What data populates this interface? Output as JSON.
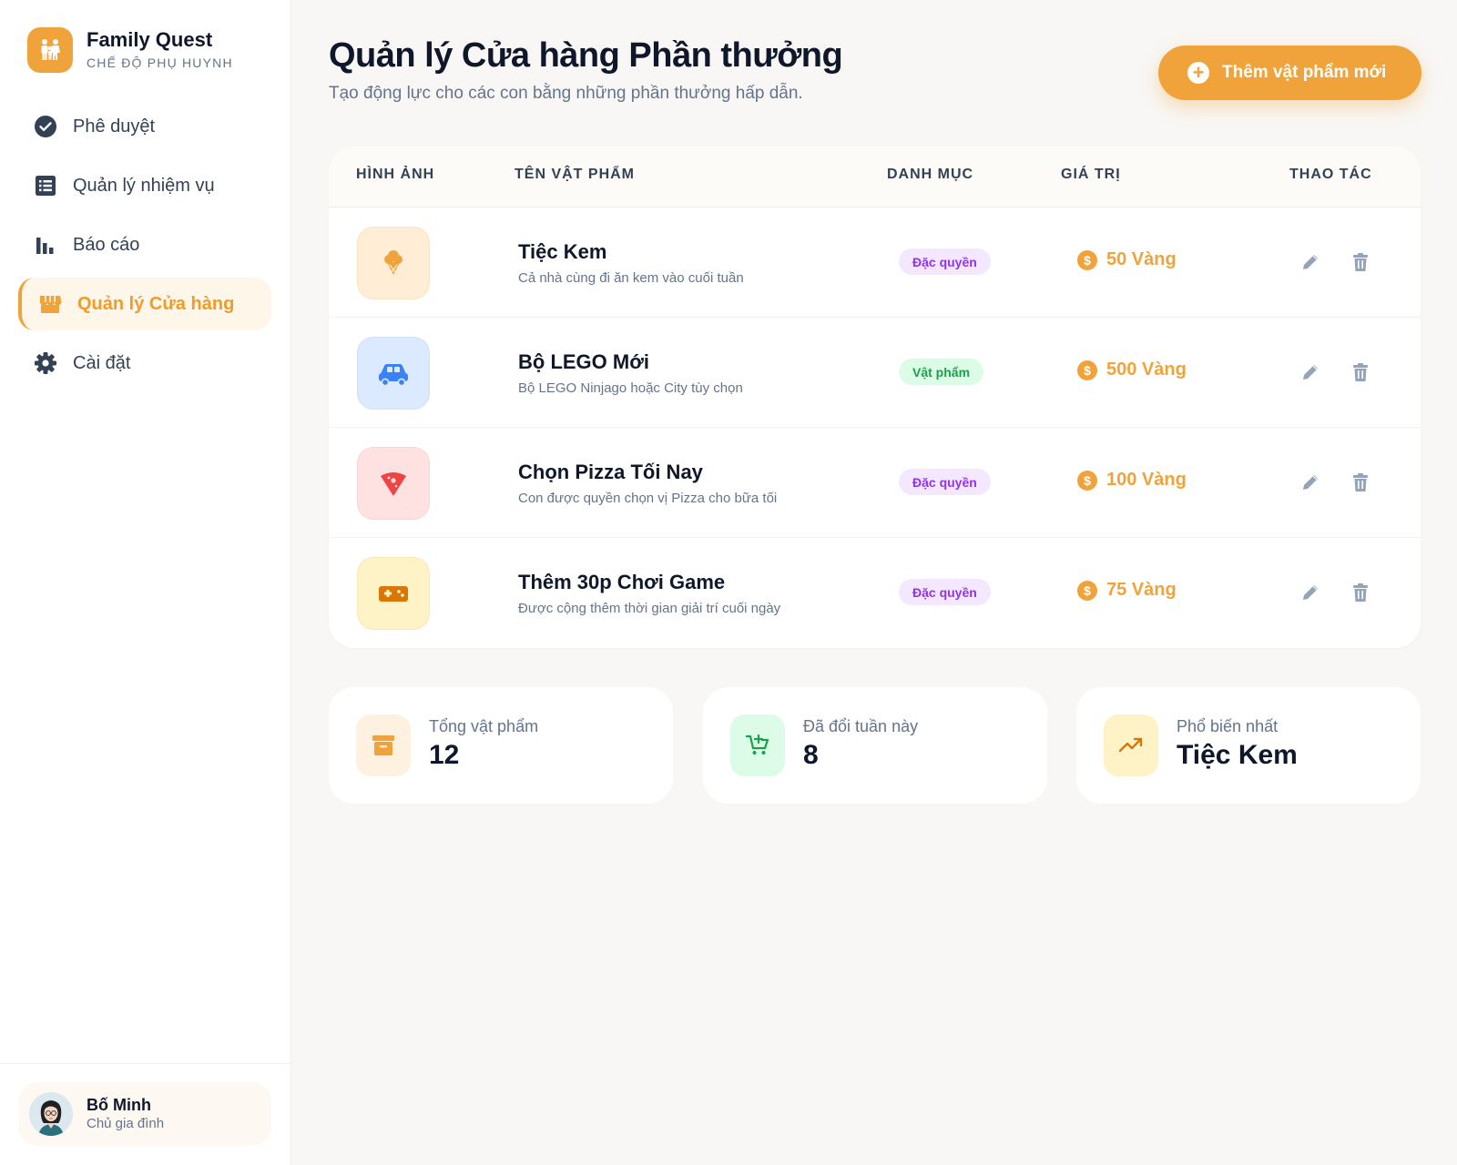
{
  "brand": {
    "title": "Family Quest",
    "subtitle": "CHẾ ĐỘ PHỤ HUYNH"
  },
  "nav": [
    {
      "label": "Phê duyệt",
      "icon": "check-circle-icon"
    },
    {
      "label": "Quản lý nhiệm vụ",
      "icon": "list-icon"
    },
    {
      "label": "Báo cáo",
      "icon": "bar-chart-icon"
    },
    {
      "label": "Quản lý Cửa hàng",
      "icon": "store-icon",
      "active": true
    },
    {
      "label": "Cài đặt",
      "icon": "gear-icon"
    }
  ],
  "profile": {
    "name": "Bố Minh",
    "role": "Chủ gia đình"
  },
  "header": {
    "title": "Quản lý Cửa hàng Phần thưởng",
    "subtitle": "Tạo động lực cho các con bằng những phần thưởng hấp dẫn.",
    "add_button": "Thêm vật phẩm mới"
  },
  "table": {
    "columns": [
      "HÌNH ẢNH",
      "TÊN VẬT PHẨM",
      "DANH MỤC",
      "GIÁ TRỊ",
      "THAO TÁC"
    ],
    "rows": [
      {
        "name": "Tiệc Kem",
        "desc": "Cả nhà cùng đi ăn kem vào cuối tuần",
        "category": "Đặc quyền",
        "price": "50 Vàng",
        "icon": "ice-cream-icon"
      },
      {
        "name": "Bộ LEGO Mới",
        "desc": "Bộ LEGO Ninjago hoặc City tùy chọn",
        "category": "Vật phẩm",
        "price": "500 Vàng",
        "icon": "car-icon"
      },
      {
        "name": "Chọn Pizza Tối Nay",
        "desc": "Con được quyền chọn vị Pizza cho bữa tối",
        "category": "Đặc quyền",
        "price": "100 Vàng",
        "icon": "pizza-icon"
      },
      {
        "name": "Thêm 30p Chơi Game",
        "desc": "Được cộng thêm thời gian giải trí cuối ngày",
        "category": "Đặc quyền",
        "price": "75 Vàng",
        "icon": "gamepad-icon"
      }
    ]
  },
  "stats": [
    {
      "label": "Tổng vật phẩm",
      "value": "12",
      "icon": "archive-icon"
    },
    {
      "label": "Đã đổi tuần này",
      "value": "8",
      "icon": "cart-icon"
    },
    {
      "label": "Phổ biến nhất",
      "value": "Tiệc Kem",
      "icon": "trending-up-icon"
    }
  ],
  "colors": {
    "accent": "#f0a33a",
    "privilege": "#9333ea",
    "item": "#16a34a"
  }
}
